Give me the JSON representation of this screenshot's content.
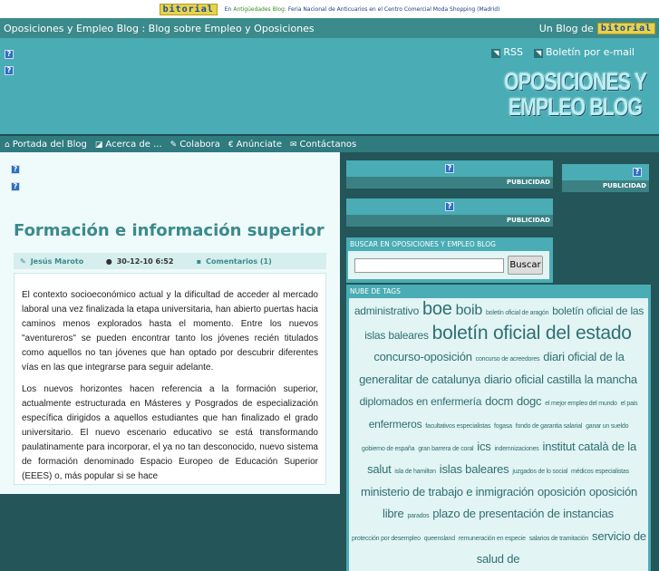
{
  "topbar": {
    "logo": "bitorial",
    "prefix": "En",
    "link": "Antigüedades Blog:",
    "text": "Feria Nacional de Anticuarios en el Centro Comercial Moda Shopping (Madrid)"
  },
  "titlebar": {
    "title": "Oposiciones y Empleo Blog : Blog sobre Empleo y Oposiciones",
    "network": "Un Blog de",
    "network_logo": "bitorial"
  },
  "header": {
    "rss": "RSS",
    "newsletter": "Boletín por e-mail",
    "logo_line1": "OPOSICIONES Y",
    "logo_line2": "EMPLEO BLOG"
  },
  "nav": [
    {
      "icon": "home-icon",
      "glyph": "⌂",
      "label": "Portada del Blog"
    },
    {
      "icon": "page-icon",
      "glyph": "◪",
      "label": "Acerca de ..."
    },
    {
      "icon": "pencil-icon",
      "glyph": "✎",
      "label": "Colabora"
    },
    {
      "icon": "euro-icon",
      "glyph": "€",
      "label": "Anúnciate"
    },
    {
      "icon": "mail-icon",
      "glyph": "✉",
      "label": "Contáctanos"
    }
  ],
  "post": {
    "title": "Formación e información superior",
    "author": "Jesús Maroto",
    "date": "30-12-10 6:52",
    "comments": "Comentarios (1)",
    "paragraphs": [
      "El contexto socioeconómico actual y la dificultad de acceder al mercado laboral una vez finalizada la etapa universitaria, han abierto puertas hacia caminos menos explorados hasta el momento. Entre los nuevos \"aventureros\" se pueden encontrar tanto los jóvenes recién titulados como aquellos no tan jóvenes que han optado por descubrir diferentes vías en las que integrarse para seguir adelante.",
      "Los nuevos horizontes hacen referencia a la formación superior, actualmente estructurada en Másteres y Posgrados de especialización específica dirigidos a aquellos estudiantes que han finalizado el grado universitario. El nuevo escenario educativo se está transformando paulatinamente para incorporar, el ya no tan desconocido, nuevo sistema de formación denominado Espacio Europeo de Educación Superior (EEES) o, más popular si se hace"
    ]
  },
  "sidebar": {
    "ad_label": "PUBLICIDAD",
    "search_title": "BUSCAR EN OPOSICIONES Y EMPLEO BLOG",
    "search_value": "",
    "search_button": "Buscar",
    "tags_title": "NUBE DE TAGS",
    "tags": [
      [
        "administrativo",
        12
      ],
      [
        "boe",
        20
      ],
      [
        "boib",
        16
      ],
      [
        "boletín oficial de aragón",
        7
      ],
      [
        "boletín oficial de las islas baleares",
        12
      ],
      [
        "boletín oficial del estado",
        21
      ],
      [
        "concurso-oposición",
        13
      ],
      [
        "concurso de acreedores",
        7
      ],
      [
        "diari oficial de la generalitar de catalunya",
        13
      ],
      [
        "diario oficial castilla la mancha",
        13
      ],
      [
        "diplomados en enfermería",
        12
      ],
      [
        "docm",
        13
      ],
      [
        "dogc",
        13
      ],
      [
        "el mejor empleo del mundo",
        7
      ],
      [
        "el pais",
        7
      ],
      [
        "enfermeros",
        12
      ],
      [
        "facultativos especialistas",
        7
      ],
      [
        "fogasa",
        7
      ],
      [
        "fondo de garantia salarial",
        7
      ],
      [
        "ganar un sueldo",
        7
      ],
      [
        "gobierno de españa",
        7
      ],
      [
        "gran barrera de coral",
        7
      ],
      [
        "ics",
        13
      ],
      [
        "indemnizaciones",
        7
      ],
      [
        "institut català de la salut",
        13
      ],
      [
        "isla de hamilton",
        7
      ],
      [
        "islas baleares",
        13
      ],
      [
        "juzgados de lo social",
        7
      ],
      [
        "médicos especialistas",
        7
      ],
      [
        "ministerio de trabajo e inmigración",
        13
      ],
      [
        "oposición",
        13
      ],
      [
        "oposición libre",
        13
      ],
      [
        "parados",
        7
      ],
      [
        "plazo de presentación de instancias",
        13
      ],
      [
        "protección por desempleo",
        7
      ],
      [
        "queensland",
        7
      ],
      [
        "remuneración en especie",
        7
      ],
      [
        "salarios de tramitación",
        7
      ],
      [
        "servicio de salud de",
        13
      ]
    ]
  }
}
